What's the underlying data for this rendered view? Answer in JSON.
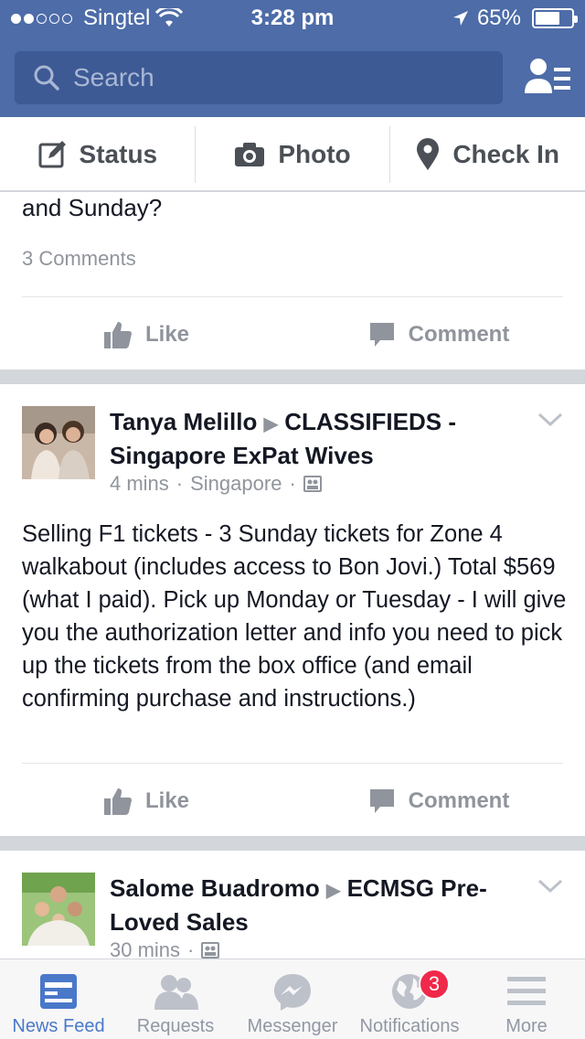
{
  "status_bar": {
    "carrier": "Singtel",
    "time": "3:28 pm",
    "battery": "65%",
    "battery_level": 0.65
  },
  "search": {
    "placeholder": "Search"
  },
  "composer": {
    "status_label": "Status",
    "photo_label": "Photo",
    "checkin_label": "Check In"
  },
  "posts": [
    {
      "body_tail": "and Sunday?",
      "comments": "3 Comments",
      "like_label": "Like",
      "comment_label": "Comment"
    },
    {
      "author": "Tanya Melillo",
      "group": "CLASSIFIEDS - Singapore ExPat Wives",
      "time": "4 mins",
      "location": "Singapore",
      "body": "Selling F1 tickets - 3 Sunday tickets for Zone 4 walkabout (includes access to Bon Jovi.) Total $569 (what I paid).  Pick up Monday or Tuesday - I will give you the authorization letter and info you need to pick up the tickets from the box office (and email confirming purchase and instructions.)",
      "like_label": "Like",
      "comment_label": "Comment"
    },
    {
      "author": "Salome Buadromo",
      "group": "ECMSG Pre-Loved Sales",
      "time": "30 mins"
    }
  ],
  "tabbar": {
    "items": [
      {
        "label": "News Feed",
        "icon": "news-feed-icon",
        "active": true
      },
      {
        "label": "Requests",
        "icon": "requests-icon"
      },
      {
        "label": "Messenger",
        "icon": "messenger-icon"
      },
      {
        "label": "Notifications",
        "icon": "globe-icon",
        "badge": "3"
      },
      {
        "label": "More",
        "icon": "menu-icon"
      }
    ]
  },
  "colors": {
    "header": "#4d6ca8",
    "accent": "#4a78c9",
    "badge": "#f02849"
  }
}
